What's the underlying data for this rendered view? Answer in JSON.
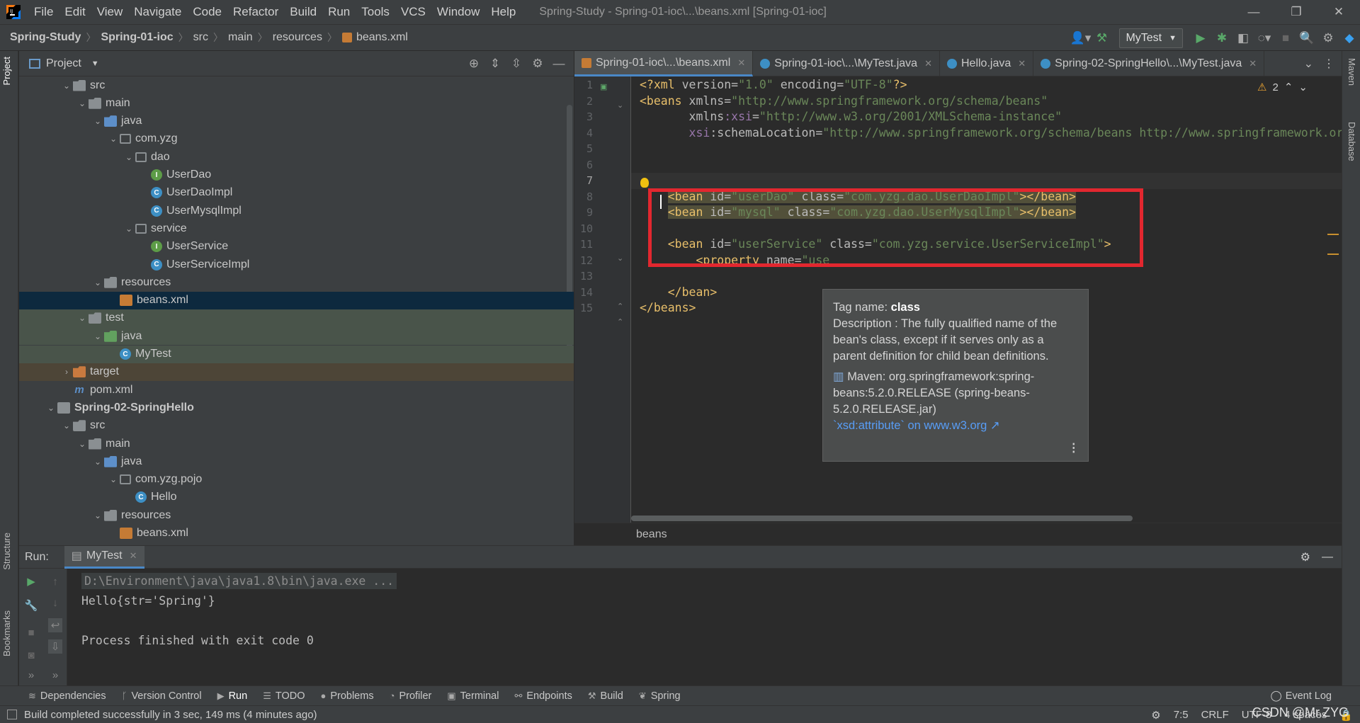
{
  "menubar": {
    "items": [
      "File",
      "Edit",
      "View",
      "Navigate",
      "Code",
      "Refactor",
      "Build",
      "Run",
      "Tools",
      "VCS",
      "Window",
      "Help"
    ],
    "window_title": "Spring-Study - Spring-01-ioc\\...\\beans.xml [Spring-01-ioc]"
  },
  "navbar": {
    "crumbs": [
      "Spring-Study",
      "Spring-01-ioc",
      "src",
      "main",
      "resources",
      "beans.xml"
    ],
    "run_config": "MyTest"
  },
  "project_panel": {
    "title": "Project",
    "tree": [
      {
        "label": "src",
        "icon": "folder",
        "depth": 2,
        "arrow": "open"
      },
      {
        "label": "main",
        "icon": "folder",
        "depth": 3,
        "arrow": "open"
      },
      {
        "label": "java",
        "icon": "folder-blue",
        "depth": 4,
        "arrow": "open"
      },
      {
        "label": "com.yzg",
        "icon": "package",
        "depth": 5,
        "arrow": "open"
      },
      {
        "label": "dao",
        "icon": "package",
        "depth": 6,
        "arrow": "open"
      },
      {
        "label": "UserDao",
        "icon": "interface",
        "depth": 7,
        "arrow": ""
      },
      {
        "label": "UserDaoImpl",
        "icon": "class",
        "depth": 7,
        "arrow": ""
      },
      {
        "label": "UserMysqlImpl",
        "icon": "class",
        "depth": 7,
        "arrow": ""
      },
      {
        "label": "service",
        "icon": "package",
        "depth": 6,
        "arrow": "open"
      },
      {
        "label": "UserService",
        "icon": "interface",
        "depth": 7,
        "arrow": ""
      },
      {
        "label": "UserServiceImpl",
        "icon": "class",
        "depth": 7,
        "arrow": ""
      },
      {
        "label": "resources",
        "icon": "folder-res",
        "depth": 4,
        "arrow": "open"
      },
      {
        "label": "beans.xml",
        "icon": "xml",
        "depth": 5,
        "arrow": "",
        "state": "selected"
      },
      {
        "label": "test",
        "icon": "folder",
        "depth": 3,
        "arrow": "open",
        "state": "test"
      },
      {
        "label": "java",
        "icon": "folder-green",
        "depth": 4,
        "arrow": "open",
        "state": "test"
      },
      {
        "label": "MyTest",
        "icon": "class",
        "depth": 5,
        "arrow": "",
        "state": "test"
      },
      {
        "label": "target",
        "icon": "folder-orange",
        "depth": 2,
        "arrow": "closed",
        "state": "target"
      },
      {
        "label": "pom.xml",
        "icon": "maven",
        "depth": 2,
        "arrow": ""
      },
      {
        "label": "Spring-02-SpringHello",
        "icon": "module",
        "depth": 1,
        "arrow": "open",
        "bold": true
      },
      {
        "label": "src",
        "icon": "folder",
        "depth": 2,
        "arrow": "open"
      },
      {
        "label": "main",
        "icon": "folder",
        "depth": 3,
        "arrow": "open"
      },
      {
        "label": "java",
        "icon": "folder-blue",
        "depth": 4,
        "arrow": "open"
      },
      {
        "label": "com.yzg.pojo",
        "icon": "package",
        "depth": 5,
        "arrow": "open"
      },
      {
        "label": "Hello",
        "icon": "class",
        "depth": 6,
        "arrow": ""
      },
      {
        "label": "resources",
        "icon": "folder-res",
        "depth": 4,
        "arrow": "open"
      },
      {
        "label": "beans.xml",
        "icon": "xml",
        "depth": 5,
        "arrow": ""
      },
      {
        "label": "test",
        "icon": "folder",
        "depth": 3,
        "arrow": "open"
      }
    ]
  },
  "editor_tabs": [
    {
      "label": "Spring-01-ioc\\...\\beans.xml",
      "icon": "xml",
      "active": true
    },
    {
      "label": "Spring-01-ioc\\...\\MyTest.java",
      "icon": "class",
      "active": false
    },
    {
      "label": "Hello.java",
      "icon": "class",
      "active": false
    },
    {
      "label": "Spring-02-SpringHello\\...\\MyTest.java",
      "icon": "class",
      "active": false
    }
  ],
  "editor": {
    "warning_count": "2",
    "line_numbers": [
      "1",
      "2",
      "3",
      "4",
      "5",
      "6",
      "7",
      "8",
      "9",
      "10",
      "11",
      "12",
      "13",
      "14",
      "15"
    ],
    "lines": [
      [
        [
          "p",
          "<?"
        ],
        [
          "t",
          "xml "
        ],
        [
          "a",
          "version"
        ],
        [
          "a",
          "="
        ],
        [
          "v",
          "\"1.0\""
        ],
        [
          "a",
          " encoding"
        ],
        [
          "a",
          "="
        ],
        [
          "v",
          "\"UTF-8\""
        ],
        [
          "p",
          "?>"
        ]
      ],
      [
        [
          "t",
          "<beans "
        ],
        [
          "a",
          "xmlns"
        ],
        [
          "a",
          "="
        ],
        [
          "v",
          "\"http://www.springframework.org/schema/beans\""
        ]
      ],
      [
        [
          "a",
          "       xmlns"
        ],
        [
          "ns",
          ":xsi"
        ],
        [
          "a",
          "="
        ],
        [
          "v",
          "\"http://www.w3.org/2001/XMLSchema-instance\""
        ]
      ],
      [
        [
          "ns",
          "       xsi"
        ],
        [
          "a",
          ":schemaLocation"
        ],
        [
          "a",
          "="
        ],
        [
          "v",
          "\"http://www.springframework.org/schema/beans http://www.springframework.or"
        ]
      ],
      [],
      [],
      [],
      [
        [
          "t",
          "    <bean "
        ],
        [
          "a",
          "id"
        ],
        [
          "a",
          "="
        ],
        [
          "v",
          "\"userDao\""
        ],
        [
          "a",
          " class"
        ],
        [
          "a",
          "="
        ],
        [
          "v",
          "\"com.yzg.dao.UserDaoImpl\""
        ],
        [
          "t",
          "></bean>"
        ]
      ],
      [
        [
          "t",
          "    <bean "
        ],
        [
          "a",
          "id"
        ],
        [
          "a",
          "="
        ],
        [
          "v",
          "\"mysql\""
        ],
        [
          "a",
          " class"
        ],
        [
          "a",
          "="
        ],
        [
          "v",
          "\"com.yzg.dao.UserMysqlImpl\""
        ],
        [
          "t",
          "></bean>"
        ]
      ],
      [],
      [
        [
          "t",
          "    <bean "
        ],
        [
          "a",
          "id"
        ],
        [
          "a",
          "="
        ],
        [
          "v",
          "\"userService\""
        ],
        [
          "a",
          " class"
        ],
        [
          "a",
          "="
        ],
        [
          "v",
          "\"com.yzg.service.UserServiceImpl\""
        ],
        [
          "t",
          ">"
        ]
      ],
      [
        [
          "t",
          "        <property "
        ],
        [
          "a",
          "name"
        ],
        [
          "a",
          "="
        ],
        [
          "v",
          "\"use"
        ]
      ],
      [],
      [
        [
          "t",
          "    </bean>"
        ]
      ],
      [
        [
          "t",
          "</beans>"
        ]
      ]
    ],
    "breadcrumb": "beans"
  },
  "tooltip": {
    "tag_label": "Tag name:",
    "tag_name": "class",
    "description": "Description : The fully qualified name of the bean's class, except if it serves only as a parent definition for child bean definitions.",
    "maven": "Maven: org.springframework:spring-beans:5.2.0.RELEASE (spring-beans-5.2.0.RELEASE.jar)",
    "link": "`xsd:attribute` on www.w3.org ↗",
    "more": "⋮"
  },
  "run_panel": {
    "label": "Run:",
    "tab": "MyTest",
    "console": [
      {
        "text": "D:\\Environment\\java\\java1.8\\bin\\java.exe ...",
        "kind": "cmd"
      },
      {
        "text": "Hello{str='Spring'}",
        "kind": "out"
      },
      {
        "text": "",
        "kind": "out"
      },
      {
        "text": "Process finished with exit code 0",
        "kind": "out"
      }
    ]
  },
  "bottom_tabs": [
    {
      "label": "Dependencies",
      "icon": "≋",
      "active": false
    },
    {
      "label": "Version Control",
      "icon": "ᚴ",
      "active": false
    },
    {
      "label": "Run",
      "icon": "▶",
      "active": true
    },
    {
      "label": "TODO",
      "icon": "☰",
      "active": false
    },
    {
      "label": "Problems",
      "icon": "●",
      "active": false
    },
    {
      "label": "Profiler",
      "icon": "◔",
      "active": false
    },
    {
      "label": "Terminal",
      "icon": "▣",
      "active": false
    },
    {
      "label": "Endpoints",
      "icon": "⚯",
      "active": false
    },
    {
      "label": "Build",
      "icon": "⚒",
      "active": false
    },
    {
      "label": "Spring",
      "icon": "❦",
      "active": false
    }
  ],
  "event_log": "Event Log",
  "status_bar": {
    "message": "Build completed successfully in 3 sec, 149 ms (4 minutes ago)",
    "position": "7:5",
    "line_sep": "CRLF",
    "encoding": "UTF-8",
    "indent": "4 spaces"
  },
  "side_tabs": {
    "project": "Project",
    "structure": "Structure",
    "bookmarks": "Bookmarks",
    "maven": "Maven",
    "database": "Database"
  },
  "watermark": "CSDN @Mr.ZYG",
  "colors": {
    "accent": "#4a88c7",
    "highlight_box": "#e2272f",
    "selection": "#0d293e"
  }
}
